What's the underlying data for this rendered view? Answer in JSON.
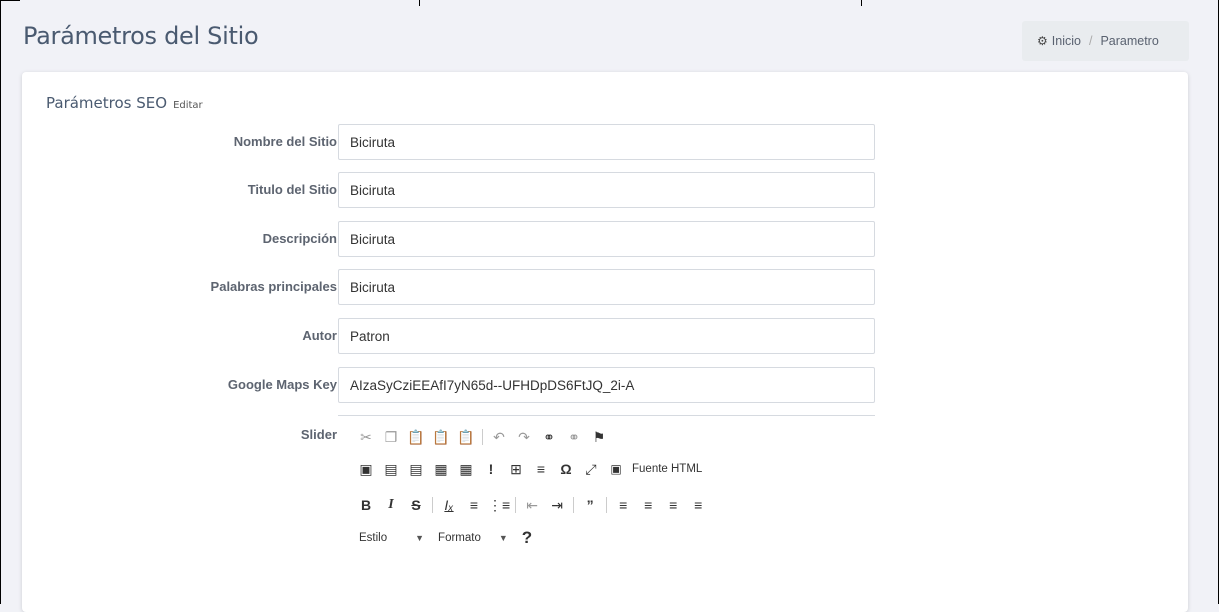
{
  "page": {
    "title": "Parámetros del Sitio"
  },
  "breadcrumb": {
    "home_label": "Inicio",
    "separator": "/",
    "current": "Parametro"
  },
  "card": {
    "title": "Parámetros SEO",
    "edit_label": "Editar"
  },
  "fields": [
    {
      "label": "Nombre del Sitio",
      "value": "Biciruta"
    },
    {
      "label": "Titulo del Sitio",
      "value": "Biciruta"
    },
    {
      "label": "Descripción",
      "value": "Biciruta"
    },
    {
      "label": "Palabras principales",
      "value": "Biciruta"
    },
    {
      "label": "Autor",
      "value": "Patron"
    },
    {
      "label": "Google Maps Key",
      "value": "AIzaSyCziEEAfI7yN65d--UFHDpDS6FtJQ_2i-A"
    }
  ],
  "slider": {
    "label": "Slider",
    "toolbar": {
      "source_label": "Fuente HTML",
      "style_label": "Estilo",
      "format_label": "Formato",
      "help_label": "?"
    }
  },
  "icons": {
    "cut": "cut-icon",
    "copy": "copy-icon",
    "paste": "paste-icon",
    "paste_text": "paste-text-icon",
    "paste_word": "paste-word-icon",
    "undo": "undo-icon",
    "redo": "redo-icon",
    "link": "link-icon",
    "unlink": "unlink-icon",
    "anchor": "anchor-flag-icon"
  }
}
